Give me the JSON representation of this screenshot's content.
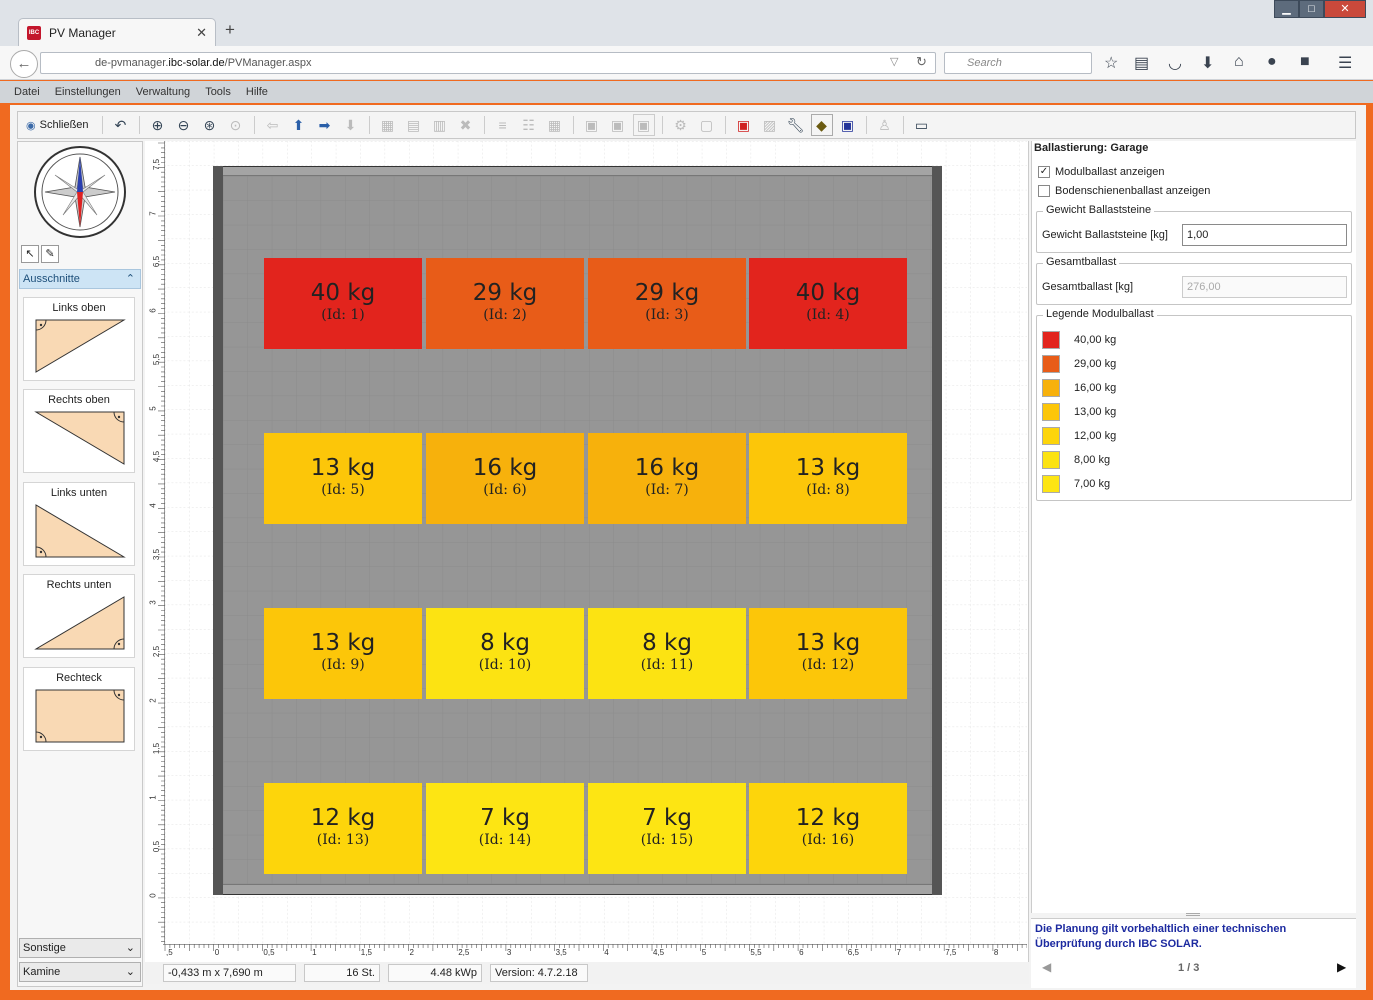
{
  "browser": {
    "tab_title": "PV Manager",
    "favicon_text": "IBC",
    "url_prefix": "de-pvmanager.",
    "url_domain": "ibc-solar.de",
    "url_path": "/PVManager.aspx",
    "search_placeholder": "Search"
  },
  "menu": [
    "Datei",
    "Einstellungen",
    "Verwaltung",
    "Tools",
    "Hilfe"
  ],
  "toolbar": {
    "close_label": "Schließen"
  },
  "left": {
    "section": "Ausschnitte",
    "shapes": [
      "Links oben",
      "Rechts oben",
      "Links unten",
      "Rechts unten",
      "Rechteck"
    ],
    "dropdowns": [
      "Sonstige",
      "Kamine"
    ]
  },
  "canvas": {
    "vruler_labels": [
      "7,5",
      "7",
      "6,5",
      "6",
      "5,5",
      "5",
      "4,5",
      "4",
      "3,5",
      "3",
      "2,5",
      "2",
      "1,5",
      "1",
      "0,5",
      "0"
    ],
    "hruler_labels": [
      ",5",
      "0",
      "0,5",
      "1",
      "1,5",
      "2",
      "2,5",
      "3",
      "3,5",
      "4",
      "4,5",
      "5",
      "5,5",
      "6",
      "6,5",
      "7",
      "7,5",
      "8"
    ],
    "modules": [
      {
        "weight": "40 kg",
        "id": "(Id: 1)",
        "color": "#e2241d"
      },
      {
        "weight": "29 kg",
        "id": "(Id: 2)",
        "color": "#e85c18"
      },
      {
        "weight": "29 kg",
        "id": "(Id: 3)",
        "color": "#e85c18"
      },
      {
        "weight": "40 kg",
        "id": "(Id: 4)",
        "color": "#e2241d"
      },
      {
        "weight": "13 kg",
        "id": "(Id: 5)",
        "color": "#fcc609"
      },
      {
        "weight": "16 kg",
        "id": "(Id: 6)",
        "color": "#f7b10c"
      },
      {
        "weight": "16 kg",
        "id": "(Id: 7)",
        "color": "#f7b10c"
      },
      {
        "weight": "13 kg",
        "id": "(Id: 8)",
        "color": "#fcc609"
      },
      {
        "weight": "13 kg",
        "id": "(Id: 9)",
        "color": "#fcc609"
      },
      {
        "weight": "8 kg",
        "id": "(Id: 10)",
        "color": "#fce312"
      },
      {
        "weight": "8 kg",
        "id": "(Id: 11)",
        "color": "#fce312"
      },
      {
        "weight": "13 kg",
        "id": "(Id: 12)",
        "color": "#fcc609"
      },
      {
        "weight": "12 kg",
        "id": "(Id: 13)",
        "color": "#fdd50b"
      },
      {
        "weight": "7 kg",
        "id": "(Id: 14)",
        "color": "#fde513"
      },
      {
        "weight": "7 kg",
        "id": "(Id: 15)",
        "color": "#fde513"
      },
      {
        "weight": "12 kg",
        "id": "(Id: 16)",
        "color": "#fdd50b"
      }
    ]
  },
  "status": {
    "dimensions": "-0,433 m x 7,690 m",
    "count": "16 St.",
    "power": "4.48 kWp",
    "version": "Version: 4.7.2.18"
  },
  "right": {
    "title": "Ballastierung: Garage",
    "check1": "Modulballast anzeigen",
    "check2": "Bodenschienenballast anzeigen",
    "group1_title": "Gewicht Ballaststeine",
    "group1_label": "Gewicht Ballaststeine [kg]",
    "group1_value": "1,00",
    "group2_title": "Gesamtballast",
    "group2_label": "Gesamtballast [kg]",
    "group2_value": "276,00",
    "legend_title": "Legende Modulballast",
    "legend": [
      {
        "label": "40,00 kg",
        "color": "#e2241d"
      },
      {
        "label": "29,00 kg",
        "color": "#e85c18"
      },
      {
        "label": "16,00 kg",
        "color": "#f7b10c"
      },
      {
        "label": "13,00 kg",
        "color": "#fcc609"
      },
      {
        "label": "12,00 kg",
        "color": "#fdd50b"
      },
      {
        "label": "8,00 kg",
        "color": "#fce312"
      },
      {
        "label": "7,00 kg",
        "color": "#fde513"
      }
    ],
    "notice": "Die Planung gilt vorbehaltlich einer technischen Überprüfung durch IBC SOLAR.",
    "pager": "1 / 3"
  }
}
